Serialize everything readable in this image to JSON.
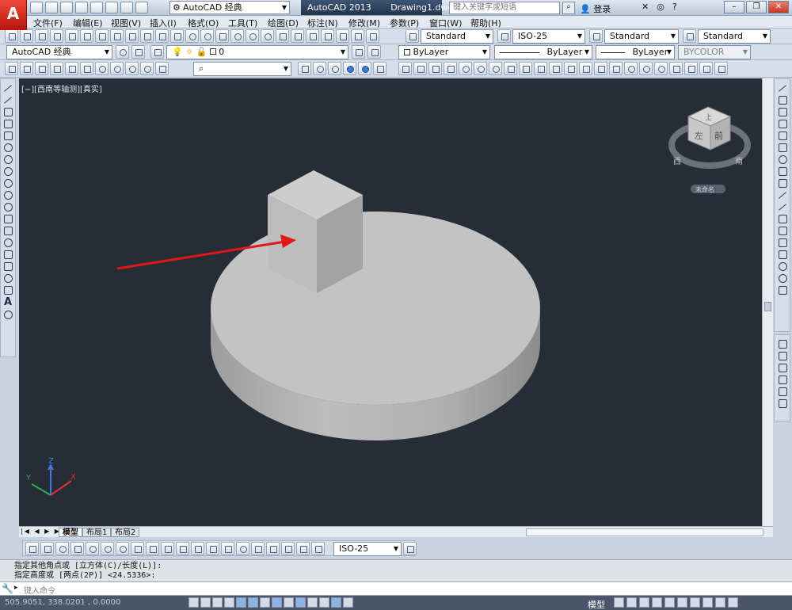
{
  "title_bar": {
    "app_name": "AutoCAD 2013",
    "document": "Drawing1.dwg",
    "workspace": "AutoCAD 经典",
    "search_placeholder": "键入关键字或短语",
    "login_label": "登录",
    "help_label": "?"
  },
  "menu": [
    "文件(F)",
    "编辑(E)",
    "视图(V)",
    "插入(I)",
    "格式(O)",
    "工具(T)",
    "绘图(D)",
    "标注(N)",
    "修改(M)",
    "参数(P)",
    "窗口(W)",
    "帮助(H)"
  ],
  "styles_toolbar": {
    "text_style": "Standard",
    "dim_style": "ISO-25",
    "table_style": "Standard",
    "multileader_style": "Standard"
  },
  "layers_toolbar": {
    "workspace": "AutoCAD 经典",
    "layer": "0"
  },
  "properties_toolbar": {
    "color": "ByLayer",
    "linetype": "ByLayer",
    "lineweight": "ByLayer",
    "plotstyle": "BYCOLOR"
  },
  "viewport": {
    "label": "[−][西南等轴测][真实]",
    "viewcube": {
      "top_face": "上",
      "left_face": "左",
      "front_face": "前",
      "compass_w": "西",
      "compass_s": "南",
      "ucs_label": "未命名"
    },
    "ucs_axes": {
      "x": "X",
      "y": "Y",
      "z": "Z"
    }
  },
  "layout_tabs": [
    "模型",
    "布局1",
    "布局2"
  ],
  "dimension_toolbar": {
    "dim_style": "ISO-25"
  },
  "command_line": {
    "history": [
      "指定其他角点或 [立方体(C)/长度(L)]:",
      "指定高度或 [两点(2P)] <24.5336>:"
    ],
    "prompt": "键入命令"
  },
  "status_bar": {
    "coordinates": "505.9051,  338.0201 , 0.0000",
    "model_label": "模型"
  },
  "colors": {
    "viewport_bg": "#262d37",
    "solid_gray": "#c3c3c3",
    "arrow_red": "#e01818"
  }
}
